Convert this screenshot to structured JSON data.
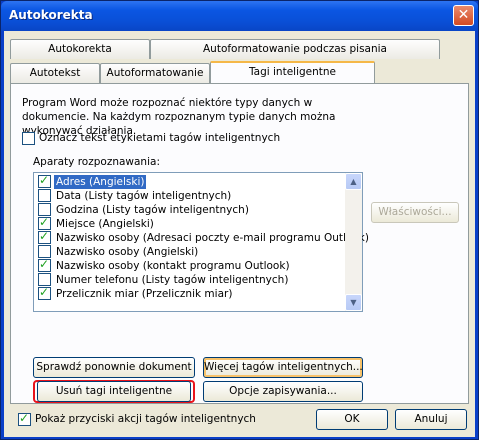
{
  "window": {
    "title": "Autokorekta"
  },
  "tabs": {
    "row1": [
      "Autokorekta",
      "Autoformatowanie podczas pisania"
    ],
    "row2": [
      "Autotekst",
      "Autoformatowanie",
      "Tagi inteligentne"
    ],
    "active": "Tagi inteligentne"
  },
  "description": "Program Word może rozpoznać niektóre typy danych w dokumencie. Na każdym rozpoznanym typie danych można wykonywać działania.",
  "tag_text_checkbox": {
    "label": "Oznacz tekst etykietami tagów inteligentnych",
    "checked": false
  },
  "recognizers_label": "Aparaty rozpoznawania:",
  "recognizers": [
    {
      "label": "Adres (Angielski)",
      "checked": true,
      "selected": true
    },
    {
      "label": "Data (Listy tagów inteligentnych)",
      "checked": false
    },
    {
      "label": "Godzina (Listy tagów inteligentnych)",
      "checked": false
    },
    {
      "label": "Miejsce (Angielski)",
      "checked": true
    },
    {
      "label": "Nazwisko osoby (Adresaci poczty e-mail programu Outlook)",
      "checked": true
    },
    {
      "label": "Nazwisko osoby (Angielski)",
      "checked": false
    },
    {
      "label": "Nazwisko osoby (kontakt programu Outlook)",
      "checked": true
    },
    {
      "label": "Numer telefonu (Listy tagów inteligentnych)",
      "checked": false
    },
    {
      "label": "Przelicznik miar (Przelicznik miar)",
      "checked": true
    }
  ],
  "buttons": {
    "properties": "Właściwości...",
    "recheck": "Sprawdź ponownie dokument",
    "more_tags": "Więcej tagów inteligentnych...",
    "remove_tags": "Usuń tagi inteligentne",
    "save_options": "Opcje zapisywania...",
    "ok": "OK",
    "cancel": "Anuluj"
  },
  "show_action_buttons": {
    "label": "Pokaż przyciski akcji tagów inteligentnych",
    "checked": true
  },
  "colors": {
    "titlebar": "#0b56e3",
    "highlight": "#e8141c",
    "selection": "#316ac5"
  }
}
